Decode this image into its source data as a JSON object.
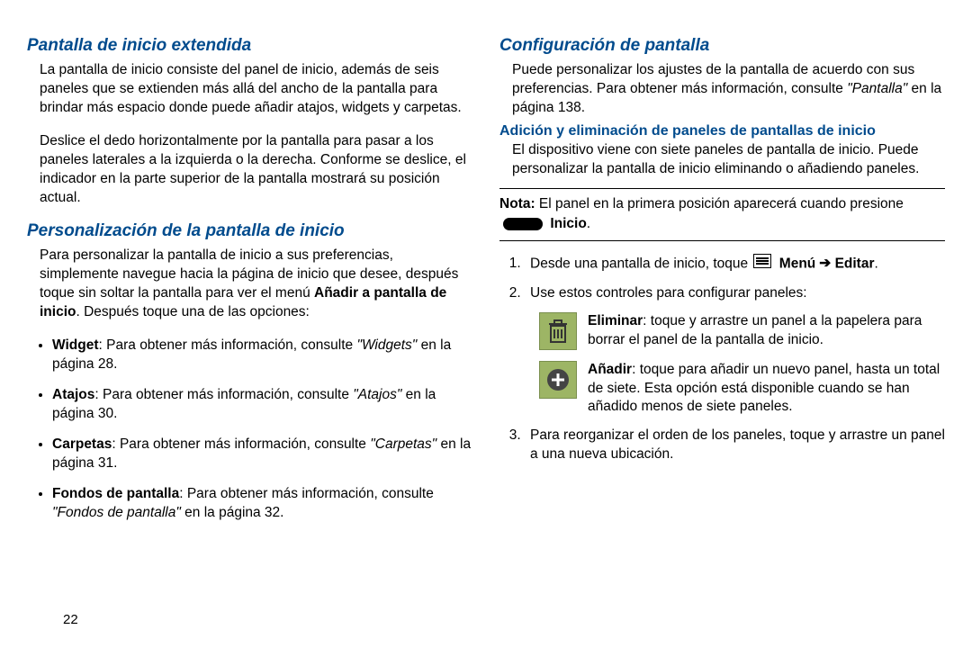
{
  "page_number": "22",
  "left": {
    "h1": "Pantalla de inicio extendida",
    "p1": "La pantalla de inicio consiste del panel de inicio, además de seis paneles que se extienden más allá del ancho de la pantalla para brindar más espacio donde puede añadir atajos, widgets y carpetas.",
    "p2": "Deslice el dedo horizontalmente por la pantalla para pasar a los paneles laterales a la izquierda o la derecha. Conforme se deslice, el indicador en la parte superior de la pantalla mostrará su posición actual.",
    "h2": "Personalización de la pantalla de inicio",
    "p3a": "Para personalizar la pantalla de inicio a sus preferencias, simplemente navegue hacia la página de inicio que desee, después toque sin soltar la pantalla para ver el menú ",
    "p3b": "Añadir a pantalla de inicio",
    "p3c": ". Después toque una de las opciones:",
    "li1a": "Widget",
    "li1b": ": Para obtener más información, consulte ",
    "li1c": "\"Widgets\"",
    "li1d": " en la página 28.",
    "li2a": "Atajos",
    "li2b": ": Para obtener más información, consulte ",
    "li2c": "\"Atajos\"",
    "li2d": " en la página 30.",
    "li3a": "Carpetas",
    "li3b": ": Para obtener más información, consulte ",
    "li3c": "\"Carpetas\"",
    "li3d": " en la página 31.",
    "li4a": "Fondos de pantalla",
    "li4b": ": Para obtener más información, consulte ",
    "li4c": "\"Fondos de pantalla\"",
    "li4d": " en la página 32."
  },
  "right": {
    "h1": "Configuración de pantalla",
    "p1a": "Puede personalizar los ajustes de la pantalla de acuerdo con sus preferencias. Para obtener más información, consulte ",
    "p1b": "\"Pantalla\"",
    "p1c": " en la página 138.",
    "h2": "Adición y eliminación de paneles de pantallas de inicio",
    "p2": "El dispositivo viene con siete paneles de pantalla de inicio. Puede personalizar la pantalla de inicio eliminando o añadiendo paneles.",
    "note_a": "Nota:",
    "note_b": " El panel en la primera posición aparecerá cuando presione ",
    "note_c": "Inicio",
    "note_d": ".",
    "ol1a": "Desde una pantalla de inicio, toque ",
    "ol1b": "Menú",
    "ol1c": "Editar",
    "ol1d": ".",
    "ol2": "Use estos controles para configurar paneles:",
    "ctrl1a": "Eliminar",
    "ctrl1b": ": toque y arrastre un panel a la papelera para borrar el panel de la pantalla de inicio.",
    "ctrl2a": "Añadir",
    "ctrl2b": ": toque para añadir un nuevo panel, hasta un total de siete. Esta opción está disponible cuando se han añadido menos de siete paneles.",
    "ol3": "Para reorganizar el orden de los paneles, toque y arrastre un panel a una nueva ubicación."
  }
}
